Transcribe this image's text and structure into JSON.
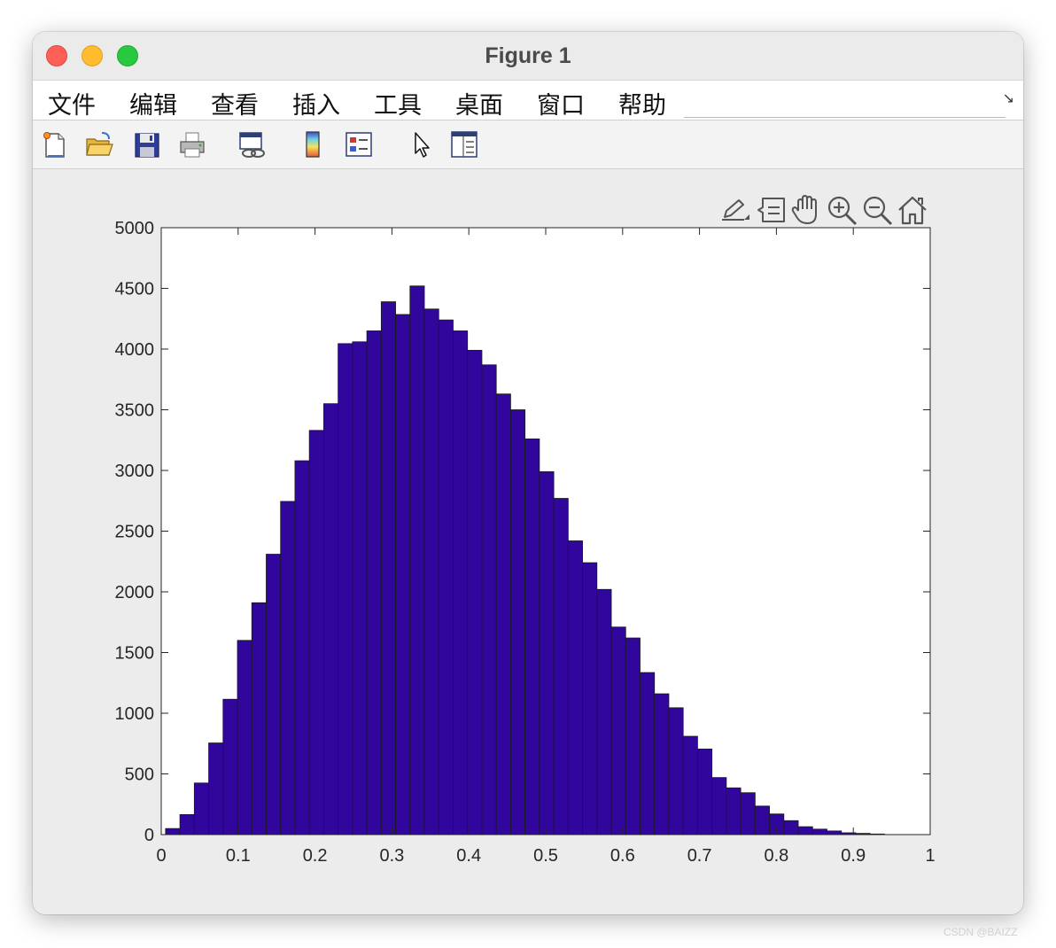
{
  "window": {
    "title": "Figure 1"
  },
  "menu": {
    "items": [
      "文件",
      "编辑",
      "查看",
      "插入",
      "工具",
      "桌面",
      "窗口",
      "帮助"
    ]
  },
  "toolbar": {
    "buttons": [
      {
        "icon": "new-figure-icon"
      },
      {
        "icon": "open-file-icon"
      },
      {
        "icon": "save-icon"
      },
      {
        "icon": "print-icon"
      },
      {
        "icon": "link-plot-icon"
      },
      {
        "icon": "colorbar-icon"
      },
      {
        "icon": "legend-icon"
      },
      {
        "icon": "edit-plot-icon"
      },
      {
        "icon": "property-editor-icon"
      }
    ]
  },
  "axes_toolbar": [
    "export-icon",
    "data-tips-icon",
    "pan-icon",
    "zoom-in-icon",
    "zoom-out-icon",
    "home-icon"
  ],
  "colors": {
    "bar_fill": "#30069c",
    "bar_edge": "#1a1a1a",
    "axes_bg": "#ffffff",
    "figure_bg": "#ececec"
  },
  "watermark": "CSDN @BAIZZ",
  "chart_data": {
    "type": "bar",
    "title": "",
    "xlabel": "",
    "ylabel": "",
    "xlim": [
      0,
      1
    ],
    "ylim": [
      0,
      5000
    ],
    "xticks": [
      "0",
      "0.1",
      "0.2",
      "0.3",
      "0.4",
      "0.5",
      "0.6",
      "0.7",
      "0.8",
      "0.9",
      "1"
    ],
    "yticks": [
      "0",
      "500",
      "1000",
      "1500",
      "2000",
      "2500",
      "3000",
      "3500",
      "4000",
      "4500",
      "5000"
    ],
    "grid": false,
    "bin_edges_start": 0.0056,
    "bin_width": 0.0187,
    "values": [
      50,
      165,
      425,
      755,
      1115,
      1600,
      1910,
      2310,
      2745,
      3080,
      3330,
      3550,
      4045,
      4060,
      4150,
      4390,
      4285,
      4520,
      4330,
      4240,
      4150,
      3990,
      3870,
      3630,
      3500,
      3260,
      2990,
      2770,
      2420,
      2240,
      2020,
      1710,
      1620,
      1335,
      1160,
      1045,
      810,
      705,
      470,
      385,
      345,
      235,
      170,
      115,
      65,
      45,
      30,
      15,
      10,
      5
    ]
  }
}
